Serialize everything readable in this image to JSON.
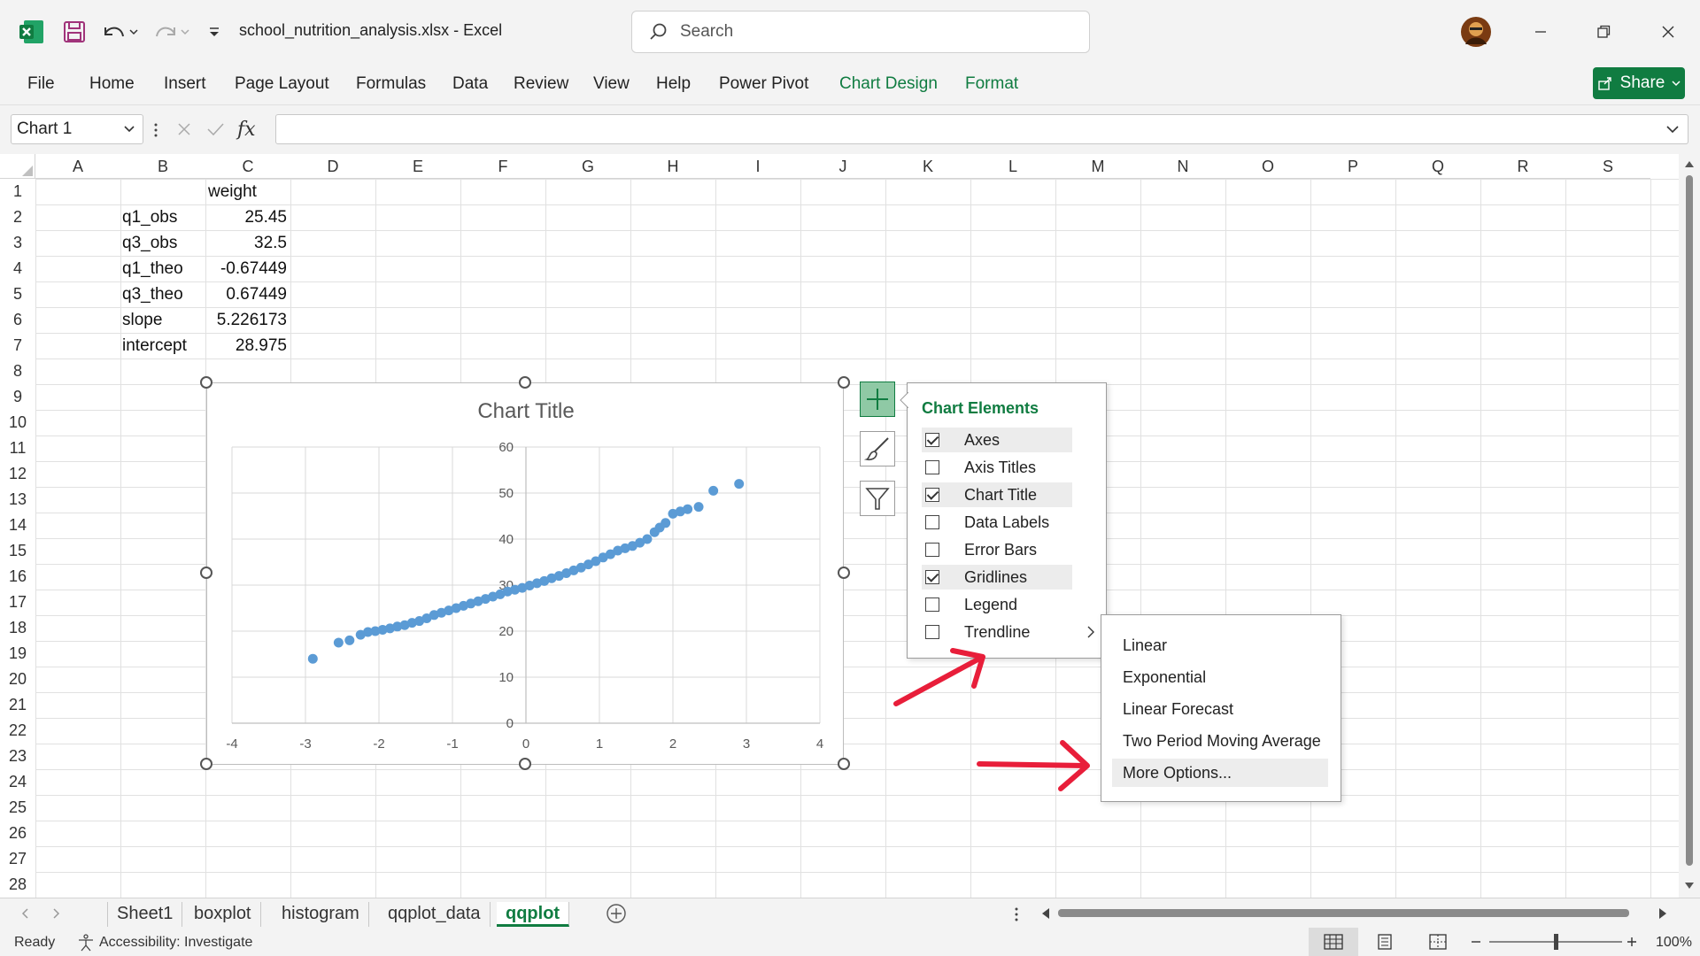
{
  "titlebar": {
    "filename": "school_nutrition_analysis.xlsx",
    "app": "Excel",
    "separator": "-",
    "search_placeholder": "Search"
  },
  "ribbon": {
    "tabs": [
      "File",
      "Home",
      "Insert",
      "Page Layout",
      "Formulas",
      "Data",
      "Review",
      "View",
      "Help",
      "Power Pivot",
      "Chart Design",
      "Format"
    ],
    "share_label": "Share"
  },
  "formula_bar": {
    "name_box": "Chart 1",
    "fx": "fx",
    "value": ""
  },
  "grid": {
    "columns": [
      "A",
      "B",
      "C",
      "D",
      "E",
      "F",
      "G",
      "H",
      "I",
      "J",
      "K",
      "L",
      "M",
      "N",
      "O",
      "P",
      "Q",
      "R",
      "S"
    ],
    "rows": [
      "1",
      "2",
      "3",
      "4",
      "5",
      "6",
      "7",
      "8",
      "9",
      "10",
      "11",
      "12",
      "13",
      "14",
      "15",
      "16",
      "17",
      "18",
      "19",
      "20",
      "21",
      "22",
      "23",
      "24",
      "25",
      "26",
      "27",
      "28"
    ],
    "cells": {
      "C1": "weight",
      "B2": "q1_obs",
      "C2": "25.45",
      "B3": "q3_obs",
      "C3": "32.5",
      "B4": "q1_theo",
      "C4": "-0.67449",
      "B5": "q3_theo",
      "C5": "0.67449",
      "B6": "slope",
      "C6": "5.226173",
      "B7": "intercept",
      "C7": "28.975"
    }
  },
  "chart": {
    "title": "Chart Title"
  },
  "chart_data": {
    "type": "scatter",
    "title": "Chart Title",
    "xlabel": "",
    "ylabel": "",
    "xlim": [
      -4,
      4
    ],
    "ylim": [
      0,
      60
    ],
    "x_ticks": [
      "-4",
      "-3",
      "-2",
      "-1",
      "0",
      "1",
      "2",
      "3",
      "4"
    ],
    "y_ticks": [
      "0",
      "10",
      "20",
      "30",
      "40",
      "50",
      "60"
    ],
    "grid": true,
    "legend": "none",
    "color": "#5b9bd5",
    "x": [
      -2.9,
      -2.55,
      -2.4,
      -2.25,
      -2.15,
      -2.05,
      -1.95,
      -1.85,
      -1.75,
      -1.65,
      -1.55,
      -1.45,
      -1.35,
      -1.25,
      -1.15,
      -1.05,
      -0.95,
      -0.85,
      -0.75,
      -0.65,
      -0.55,
      -0.45,
      -0.35,
      -0.25,
      -0.15,
      -0.05,
      0.05,
      0.15,
      0.25,
      0.35,
      0.45,
      0.55,
      0.65,
      0.75,
      0.85,
      0.95,
      1.05,
      1.15,
      1.25,
      1.35,
      1.45,
      1.55,
      1.65,
      1.75,
      1.82,
      1.9,
      2.0,
      2.1,
      2.2,
      2.35,
      2.55,
      2.9
    ],
    "y": [
      14.0,
      17.5,
      18.0,
      19.2,
      19.8,
      20.0,
      20.3,
      20.6,
      21.0,
      21.3,
      21.8,
      22.2,
      22.8,
      23.5,
      24.0,
      24.5,
      25.0,
      25.5,
      26.0,
      26.5,
      27.0,
      27.5,
      28.0,
      28.6,
      29.0,
      29.4,
      29.9,
      30.4,
      30.9,
      31.5,
      32.0,
      32.6,
      33.2,
      33.8,
      34.5,
      35.2,
      36.0,
      36.7,
      37.5,
      38.0,
      38.5,
      39.2,
      40.0,
      41.5,
      42.5,
      43.5,
      45.5,
      46.0,
      46.5,
      47.0,
      50.5,
      52.0
    ]
  },
  "flyout": {
    "title": "Chart Elements",
    "items": [
      {
        "label": "Axes",
        "checked": true
      },
      {
        "label": "Axis Titles",
        "checked": false
      },
      {
        "label": "Chart Title",
        "checked": true
      },
      {
        "label": "Data Labels",
        "checked": false
      },
      {
        "label": "Error Bars",
        "checked": false
      },
      {
        "label": "Gridlines",
        "checked": true
      },
      {
        "label": "Legend",
        "checked": false
      },
      {
        "label": "Trendline",
        "checked": false
      }
    ]
  },
  "submenu": {
    "items": [
      "Linear",
      "Exponential",
      "Linear Forecast",
      "Two Period Moving Average",
      "More Options..."
    ]
  },
  "sheets": {
    "tabs": [
      "Sheet1",
      "boxplot",
      "histogram",
      "qqplot_data",
      "qqplot"
    ],
    "active": "qqplot"
  },
  "status": {
    "ready": "Ready",
    "accessibility": "Accessibility: Investigate",
    "zoom": "100%",
    "zoom_fraction": 0.5
  },
  "colors": {
    "accent": "#107c41",
    "marker": "#5b9bd5",
    "annotation_arrow": "#e81e3a"
  }
}
